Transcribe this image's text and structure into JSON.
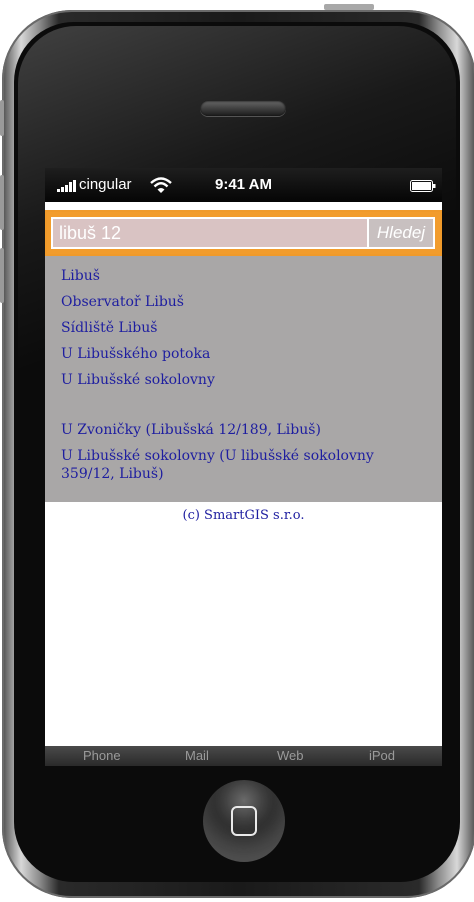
{
  "status_bar": {
    "carrier": "cingular",
    "time": "9:41 AM"
  },
  "search": {
    "value": "libuš 12",
    "button_label": "Hledej"
  },
  "results": [
    "Libuš",
    "Observatoř Libuš",
    "Sídliště Libuš",
    "U Libušského potoka",
    "U Libušské sokolovny",
    "U Zvoničky (Libušská 12/189, Libuš)",
    "U Libušské sokolovny (U libušské sokolovny",
    "359/12, Libuš)"
  ],
  "footer": "(c) SmartGIS s.r.o.",
  "tab_bar": {
    "items": [
      "Phone",
      "Mail",
      "Web",
      "iPod"
    ]
  },
  "colors": {
    "search_bar": "#f09a2a",
    "results_bg": "#a9a7a7",
    "link": "#1e1ea0"
  }
}
